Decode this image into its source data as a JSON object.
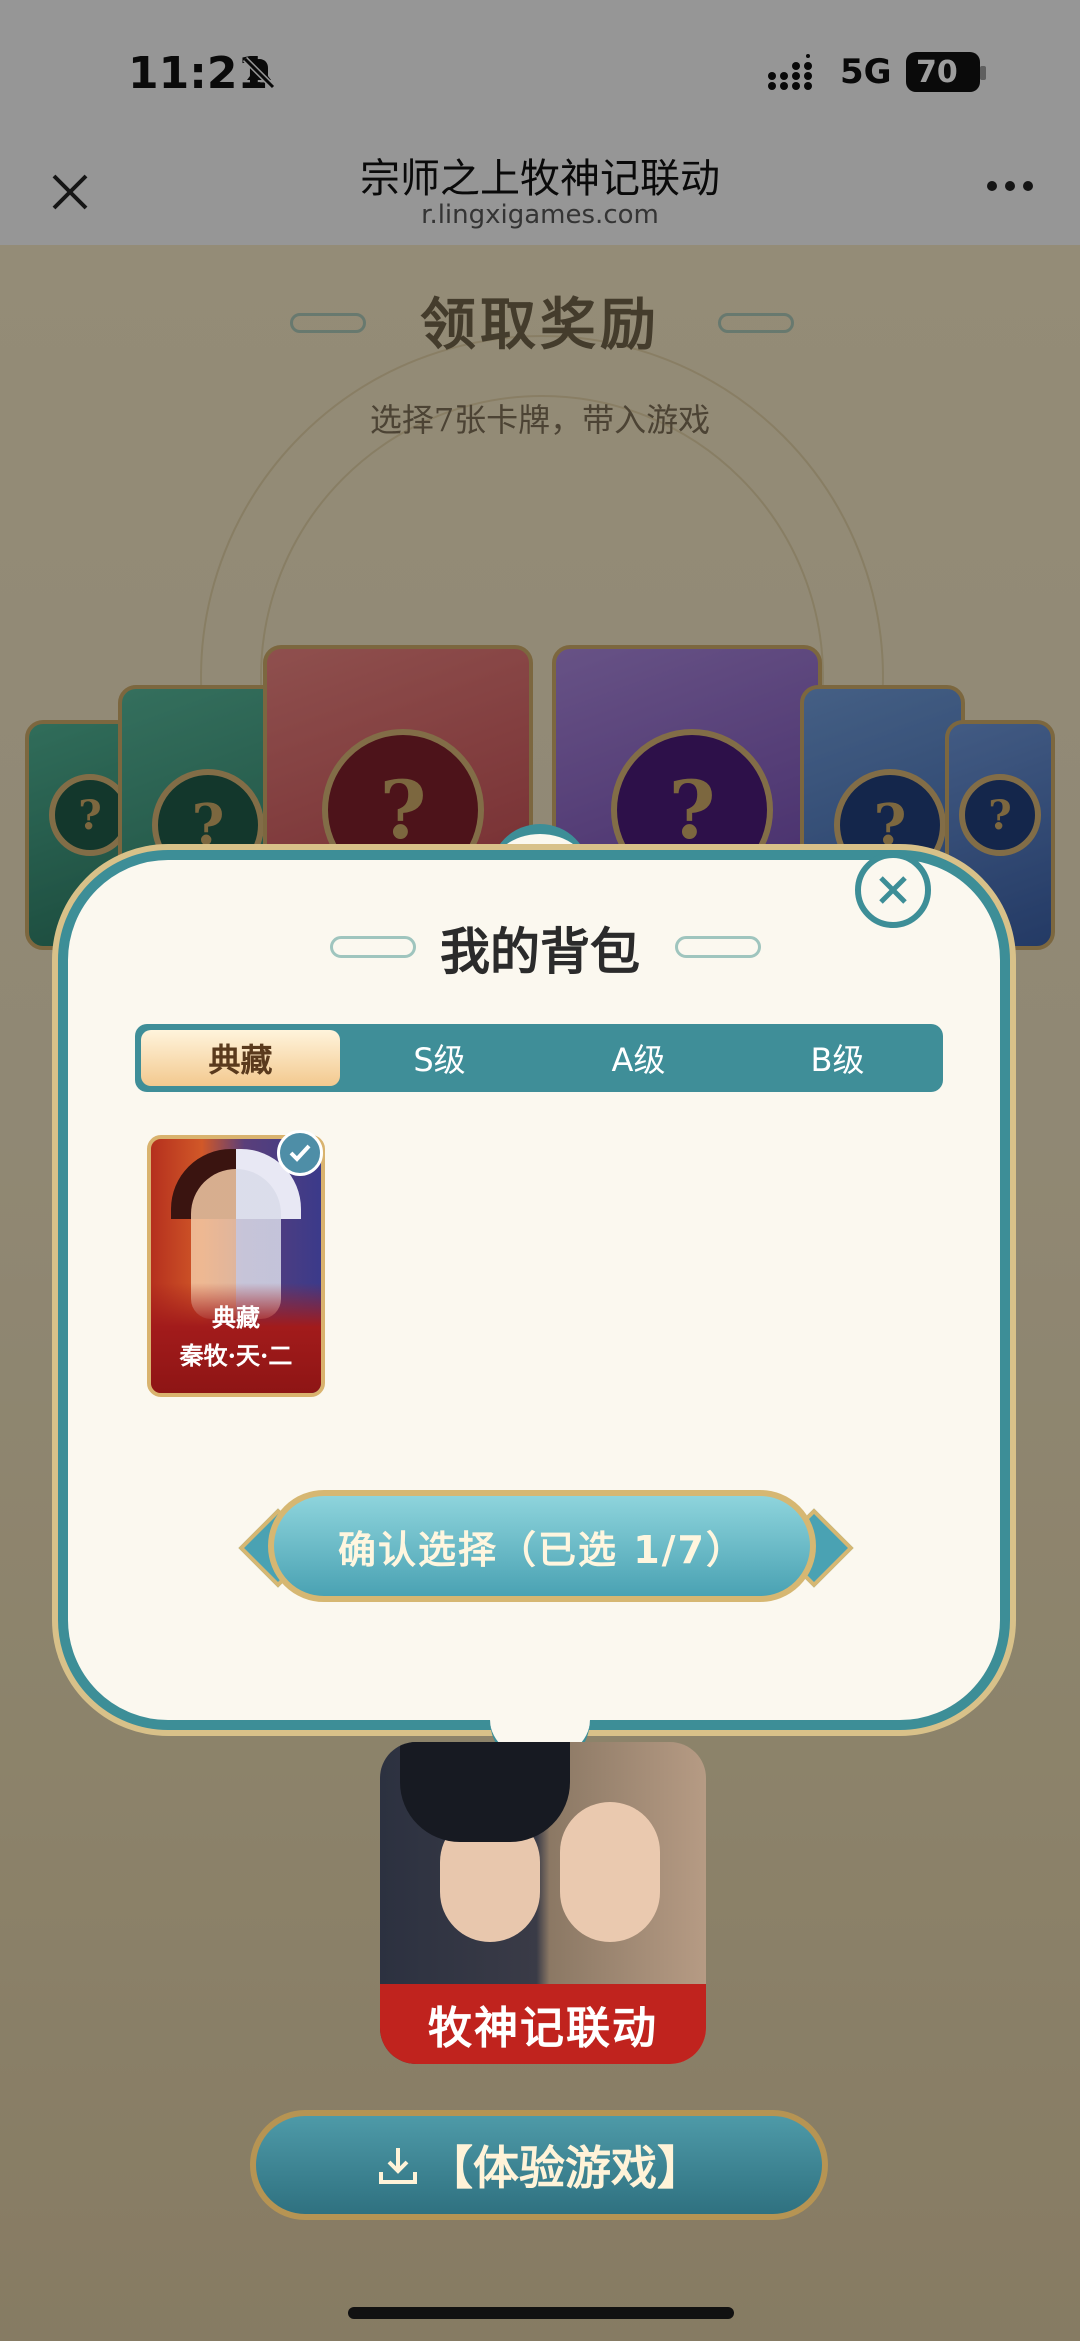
{
  "status_bar": {
    "time": "11:21",
    "network": "5G",
    "battery": "70"
  },
  "browser": {
    "title": "宗师之上牧神记联动",
    "url": "r.lingxigames.com"
  },
  "page": {
    "title": "领取奖励",
    "subtitle": "选择7张卡牌，带入游戏",
    "card_placeholder": "?"
  },
  "modal": {
    "title": "我的背包",
    "tabs": [
      {
        "label": "典藏"
      },
      {
        "label": "S级"
      },
      {
        "label": "A级"
      },
      {
        "label": "B级"
      }
    ],
    "active_tab": "典藏",
    "items": [
      {
        "rarity": "典藏",
        "name": "秦牧·天·二",
        "selected": true
      }
    ],
    "confirm_label": "确认选择（已选 1/7）"
  },
  "game": {
    "label": "牧神记联动",
    "play_button": "【体验游戏】"
  },
  "colors": {
    "teal": "#3d8e97",
    "gold": "#d6b772",
    "red": "#c0231e"
  }
}
